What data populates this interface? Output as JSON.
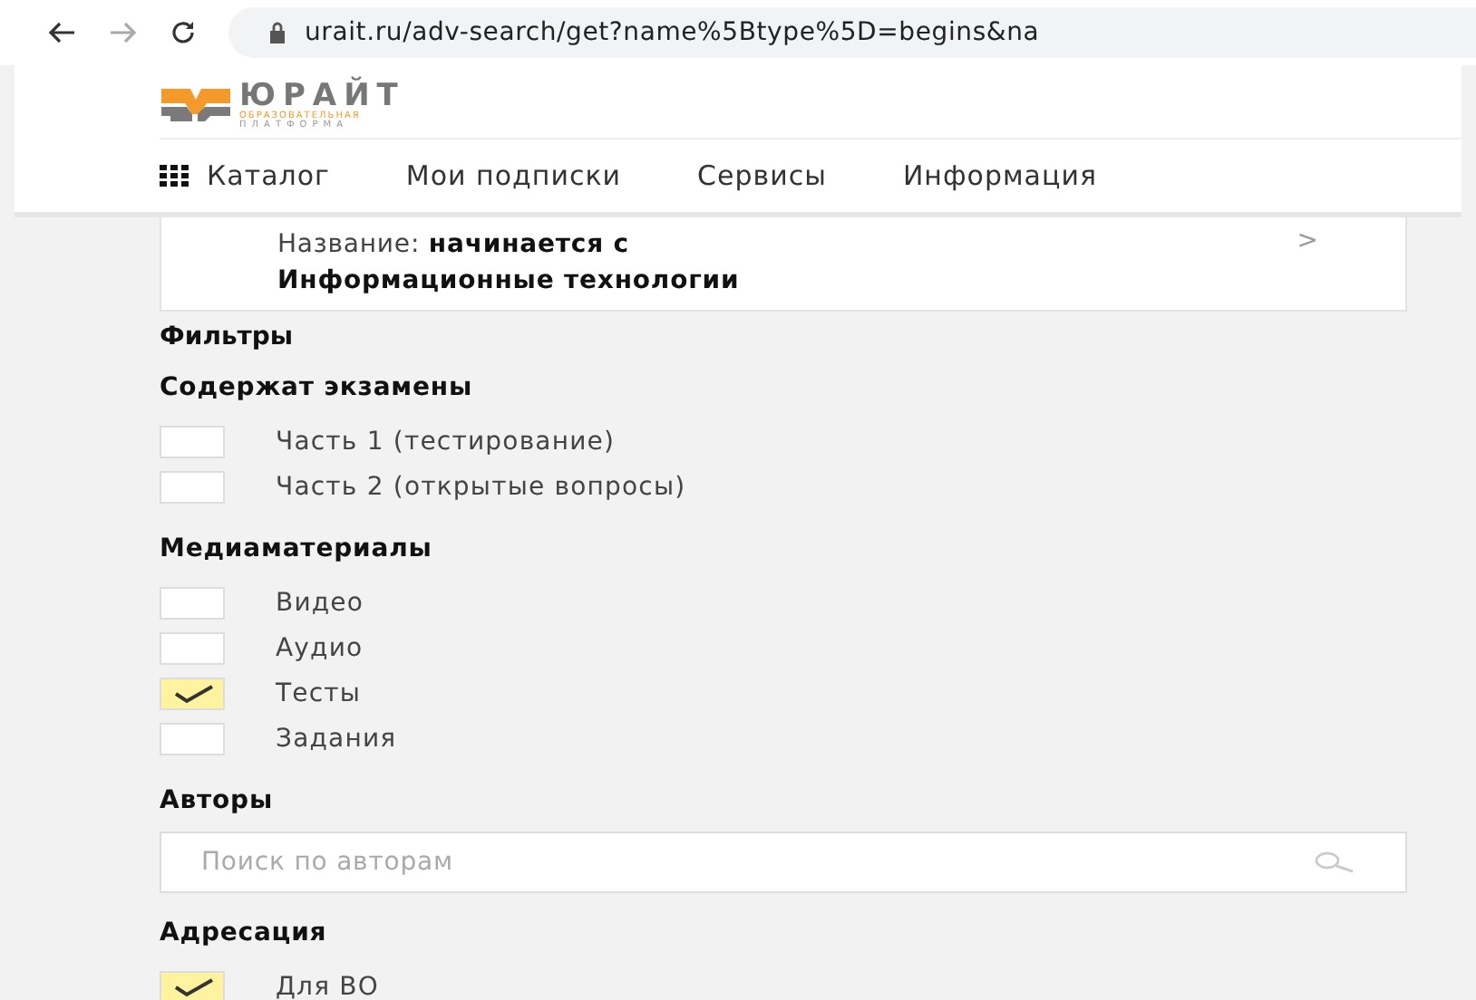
{
  "browser": {
    "url": "urait.ru/adv-search/get?name%5Btype%5D=begins&na"
  },
  "logo": {
    "name": "ЮРАЙТ",
    "line_1": "ОБРАЗОВАТЕЛЬНАЯ",
    "line_2": "ПЛАТФОРМА"
  },
  "nav": [
    "Каталог",
    "Мои подписки",
    "Сервисы",
    "Информация"
  ],
  "query": {
    "label": "Название:",
    "condition": "начинается с",
    "value": "Информационные технологии",
    "arrow": ">"
  },
  "filters_title": "Фильтры",
  "sections": [
    {
      "kind": "checkboxes",
      "title": "Содержат экзамены",
      "options": [
        {
          "label": "Часть 1 (тестирование)",
          "checked": false
        },
        {
          "label": "Часть 2 (открытые вопросы)",
          "checked": false
        }
      ]
    },
    {
      "kind": "checkboxes",
      "title": "Медиаматериалы",
      "options": [
        {
          "label": "Видео",
          "checked": false
        },
        {
          "label": "Аудио",
          "checked": false
        },
        {
          "label": "Тесты",
          "checked": true
        },
        {
          "label": "Задания",
          "checked": false
        }
      ]
    },
    {
      "kind": "search",
      "title": "Авторы",
      "placeholder": "Поиск по авторам"
    },
    {
      "kind": "checkboxes",
      "title": "Адресация",
      "options": [
        {
          "label": "Для ВО",
          "checked": true
        }
      ]
    }
  ]
}
